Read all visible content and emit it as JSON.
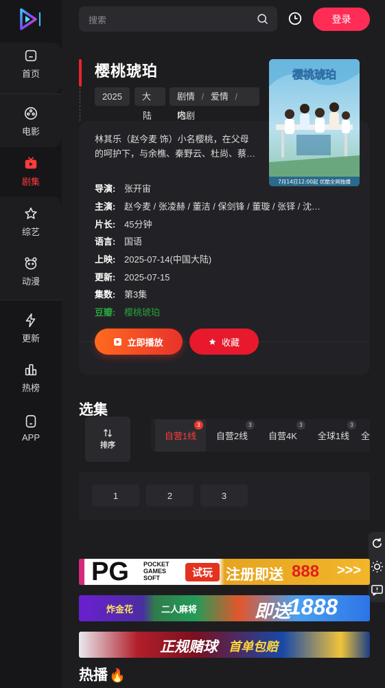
{
  "sidebar": {
    "items": [
      {
        "label": "首页",
        "icon": "home-icon"
      },
      {
        "label": "电影",
        "icon": "film-reel-icon"
      },
      {
        "label": "剧集",
        "icon": "tv-icon",
        "active": true
      },
      {
        "label": "综艺",
        "icon": "star-icon"
      },
      {
        "label": "动漫",
        "icon": "bear-face-icon"
      },
      {
        "label": "更新",
        "icon": "lightning-icon"
      },
      {
        "label": "热榜",
        "icon": "chart-bars-icon"
      },
      {
        "label": "APP",
        "icon": "phone-icon"
      }
    ]
  },
  "header": {
    "search_placeholder": "搜索",
    "login_label": "登录"
  },
  "detail": {
    "title": "樱桃琥珀",
    "tags": {
      "year": "2025",
      "region_1": "大",
      "region_2": "陆",
      "genre_1": "剧情",
      "sep_1": "/",
      "genre_2": "爱情",
      "sep_2": "/",
      "genre_3a": "内",
      "genre_3b": "地剧"
    },
    "poster_caption": "7月14日12:00起 优酷全网独播",
    "description": "林其乐（赵今麦 饰）小名樱桃，在父母的呵护下，与余樵、秦野云、杜尚、蔡…",
    "info": [
      {
        "key": "导演:",
        "value": "张开宙"
      },
      {
        "key": "主演:",
        "value": "赵今麦  /  张凌赫  /  董洁  /  保剑锋  /  董璇  /  张铎  /  沈…"
      },
      {
        "key": "片长:",
        "value": "45分钟"
      },
      {
        "key": "语言:",
        "value": "国语"
      },
      {
        "key": "上映:",
        "value": "2025-07-14(中国大陆)"
      },
      {
        "key": "更新:",
        "value": "2025-07-15"
      },
      {
        "key": "集数:",
        "value": "第3集"
      },
      {
        "key": "豆瓣:",
        "value": "樱桃琥珀"
      }
    ],
    "play_label": "立即播放",
    "fav_label": "收藏"
  },
  "episodes": {
    "section_title": "选集",
    "sort_label": "排序",
    "sources": [
      {
        "label": "自营1线",
        "count": "3"
      },
      {
        "label": "自营2线",
        "count": "3"
      },
      {
        "label": "自营4K",
        "count": "3"
      },
      {
        "label": "全球1线",
        "count": "3"
      },
      {
        "label": "全",
        "count": ""
      }
    ],
    "items": [
      "1",
      "2",
      "3"
    ]
  },
  "banners": [
    {
      "brand": "PG",
      "brand_sub_1": "POCKET",
      "brand_sub_2": "GAMES",
      "brand_sub_3": "SOFT",
      "badge": "试玩",
      "text": "注册即送",
      "number": "888",
      "arrows": ">>>"
    },
    {
      "label_1": "炸金花",
      "label_2": "二人麻将",
      "text": "即送",
      "number": "1888"
    },
    {
      "text_1": "正规赌球",
      "text_2": "首单包赔"
    }
  ],
  "hot": {
    "title": "热播",
    "emoji": "🔥"
  },
  "colors": {
    "accent": "#ff2d55",
    "active": "#ff3b3b",
    "douban": "#27a33a",
    "background": "#1d1d20"
  }
}
